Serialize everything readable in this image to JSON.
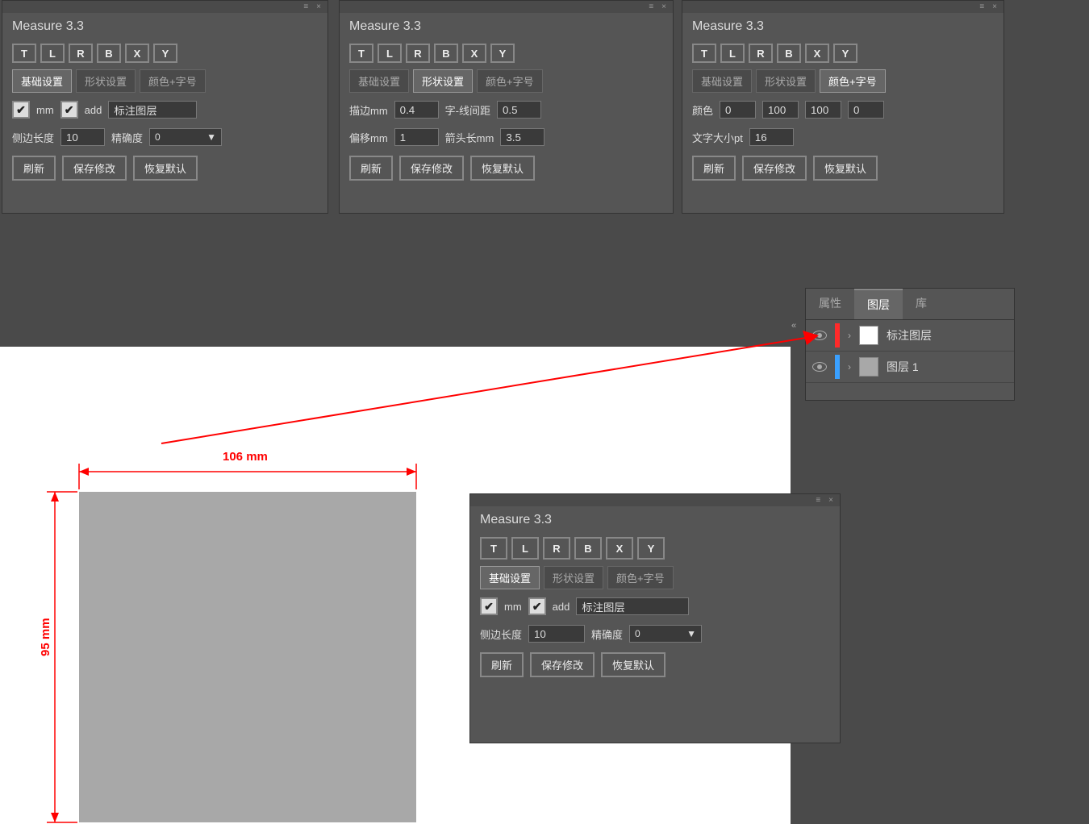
{
  "panel_title": "Measure 3.3",
  "dir_buttons": [
    "T",
    "L",
    "R",
    "B",
    "X",
    "Y"
  ],
  "tabs": {
    "basic": "基础设置",
    "shape": "形状设置",
    "color": "颜色+字号"
  },
  "basic": {
    "mm": "mm",
    "add": "add",
    "layer_name": "标注图层",
    "side_length_label": "侧边长度",
    "side_length_value": "10",
    "precision_label": "精确度",
    "precision_value": "0"
  },
  "shape": {
    "stroke_label": "描边mm",
    "stroke_value": "0.4",
    "gap_label": "字-线间距",
    "gap_value": "0.5",
    "offset_label": "偏移mm",
    "offset_value": "1",
    "arrow_label": "箭头长mm",
    "arrow_value": "3.5"
  },
  "color": {
    "color_label": "颜色",
    "c": "0",
    "m": "100",
    "y": "100",
    "k": "0",
    "text_size_label": "文字大小pt",
    "text_size_value": "16"
  },
  "actions": {
    "refresh": "刷新",
    "save": "保存修改",
    "reset": "恢复默认"
  },
  "layers": {
    "tabs": {
      "properties": "属性",
      "layers": "图层",
      "library": "库"
    },
    "items": [
      {
        "name": "标注图层",
        "color": "#ff2a2a",
        "swatch": "#ffffff"
      },
      {
        "name": "图层 1",
        "color": "#3aa0ff",
        "swatch": "#a8a8a8"
      }
    ]
  },
  "dimensions": {
    "width": "106 mm",
    "height": "95 mm"
  },
  "collapse_icon": "≡",
  "close_icon": "×",
  "dropdown_arrow": "▼",
  "expand_chevron": "›",
  "check_glyph": "✔",
  "collapse_arrow": "«"
}
